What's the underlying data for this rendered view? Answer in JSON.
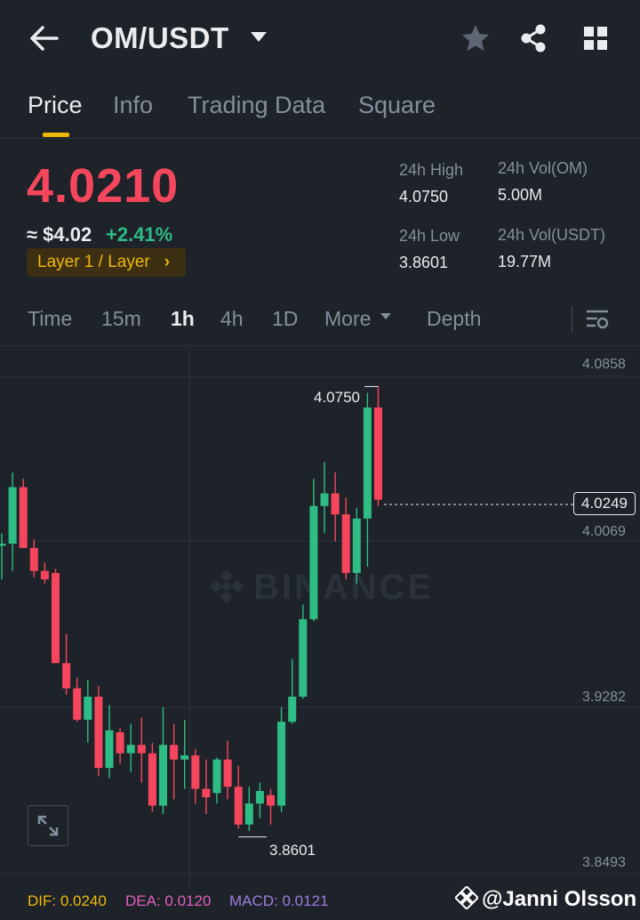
{
  "header": {
    "pair": "OM/USDT",
    "icons": [
      "back-arrow-icon",
      "favorite-star-icon",
      "share-icon",
      "grid-menu-icon"
    ]
  },
  "tabs": [
    {
      "label": "Price",
      "active": true
    },
    {
      "label": "Info",
      "active": false
    },
    {
      "label": "Trading Data",
      "active": false
    },
    {
      "label": "Square",
      "active": false
    }
  ],
  "ticker": {
    "last_price": "4.0210",
    "fiat_price": "≈ $4.02",
    "change": "+2.41%",
    "tag": "Layer 1 / Layer",
    "high_label": "24h High",
    "high_value": "4.0750",
    "low_label": "24h Low",
    "low_value": "3.8601",
    "vol_base_label": "24h Vol(OM)",
    "vol_base_value": "5.00M",
    "vol_quote_label": "24h Vol(USDT)",
    "vol_quote_value": "19.77M"
  },
  "intervals": {
    "time": "Time",
    "m15": "15m",
    "h1": "1h",
    "h4": "4h",
    "d1": "1D",
    "more": "More",
    "depth": "Depth",
    "selected": "1h"
  },
  "chart": {
    "watermark": "BINANCE",
    "last_price_label": "4.0249",
    "max_label": "4.0750",
    "min_label": "3.8601",
    "y_ticks": [
      "4.0858",
      "4.0069",
      "3.9282",
      "3.8493"
    ]
  },
  "indicators": {
    "dif": "DIF: 0.0240",
    "dea": "DEA: 0.0120",
    "macd": "MACD: 0.0121"
  },
  "credit": "@Janni Olsson",
  "colors": {
    "up": "#2ebd85",
    "down": "#f6465d",
    "accent": "#f0b90b",
    "background": "#1e2329"
  },
  "chart_data": {
    "type": "candlestick",
    "interval": "1h",
    "y_ticks": [
      4.0858,
      4.0069,
      3.9282,
      3.8493
    ],
    "ohlc": [
      [
        3.999,
        4.005,
        3.983,
        4.0
      ],
      [
        4.0,
        4.034,
        3.987,
        4.027
      ],
      [
        4.027,
        4.031,
        3.998,
        3.998
      ],
      [
        3.998,
        4.002,
        3.984,
        3.987
      ],
      [
        3.987,
        3.991,
        3.981,
        3.983
      ],
      [
        3.986,
        3.988,
        3.943,
        3.943
      ],
      [
        3.943,
        3.957,
        3.928,
        3.931
      ],
      [
        3.931,
        3.936,
        3.915,
        3.916
      ],
      [
        3.916,
        3.935,
        3.905,
        3.927
      ],
      [
        3.927,
        3.932,
        3.889,
        3.893
      ],
      [
        3.893,
        3.923,
        3.888,
        3.911
      ],
      [
        3.91,
        3.912,
        3.895,
        3.9
      ],
      [
        3.9,
        3.914,
        3.891,
        3.904
      ],
      [
        3.904,
        3.917,
        3.886,
        3.9
      ],
      [
        3.9,
        3.905,
        3.872,
        3.875
      ],
      [
        3.875,
        3.922,
        3.871,
        3.904
      ],
      [
        3.904,
        3.914,
        3.878,
        3.897
      ],
      [
        3.897,
        3.916,
        3.883,
        3.899
      ],
      [
        3.899,
        3.902,
        3.876,
        3.883
      ],
      [
        3.883,
        3.897,
        3.871,
        3.879
      ],
      [
        3.881,
        3.898,
        3.876,
        3.897
      ],
      [
        3.897,
        3.906,
        3.878,
        3.884
      ],
      [
        3.884,
        3.894,
        3.864,
        3.866
      ],
      [
        3.866,
        3.884,
        3.863,
        3.876
      ],
      [
        3.876,
        3.886,
        3.869,
        3.882
      ],
      [
        3.88,
        3.883,
        3.866,
        3.875
      ],
      [
        3.875,
        3.922,
        3.872,
        3.915
      ],
      [
        3.915,
        3.945,
        3.914,
        3.927
      ],
      [
        3.927,
        3.971,
        3.926,
        3.964
      ],
      [
        3.964,
        4.031,
        3.963,
        4.018
      ],
      [
        4.018,
        4.039,
        4.005,
        4.024
      ],
      [
        4.024,
        4.034,
        4.001,
        4.014
      ],
      [
        4.014,
        4.022,
        3.983,
        3.986
      ],
      [
        3.986,
        4.017,
        3.981,
        4.012
      ],
      [
        4.012,
        4.072,
        3.989,
        4.065
      ],
      [
        4.065,
        4.075,
        4.018,
        4.021
      ]
    ]
  }
}
